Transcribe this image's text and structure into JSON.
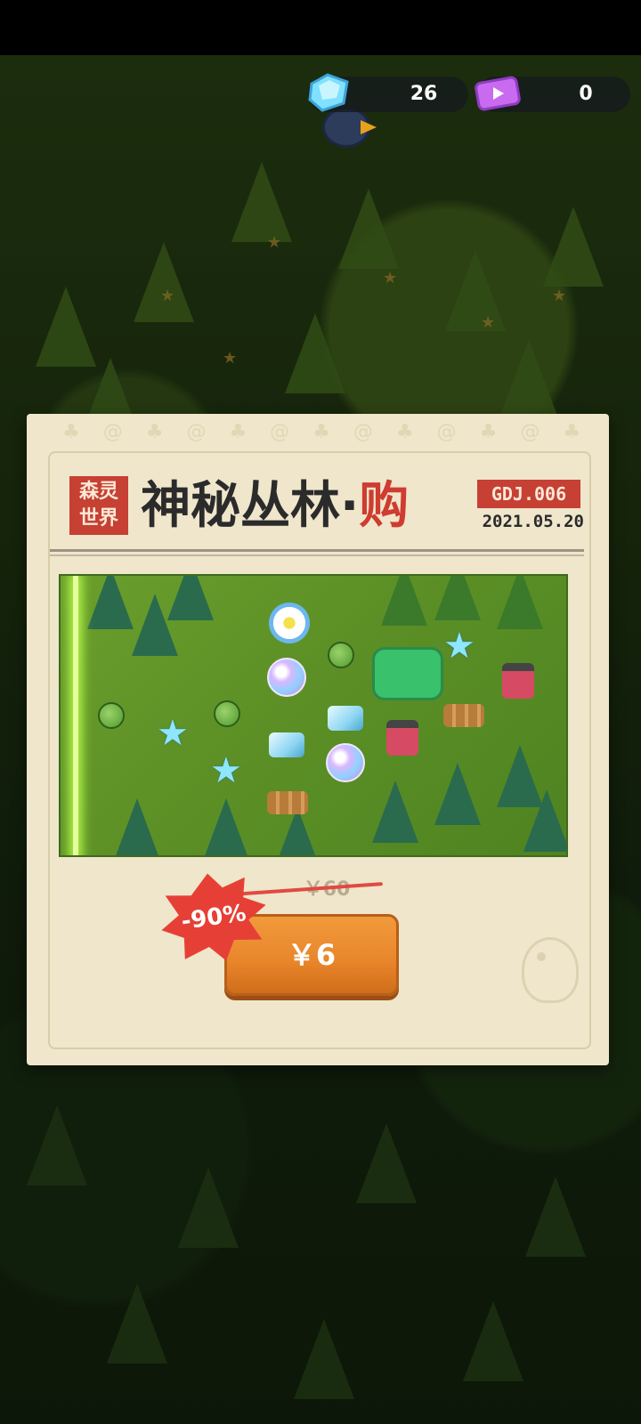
{
  "hud": {
    "gems": "26",
    "gems_icon": "gem-icon",
    "tickets": "0",
    "tickets_icon": "ticket-icon"
  },
  "offer": {
    "brand_line1": "森灵",
    "brand_line2": "世界",
    "title": "神秘丛林·",
    "title_accent": "购",
    "code": "GDJ.006",
    "date": "2021.05.20",
    "original_price": "￥60",
    "discount": "-90%",
    "buy_label": "￥6"
  },
  "colors": {
    "accent_red": "#c64034",
    "button_orange": "#e8852a",
    "panel_bg": "#efe6cc"
  }
}
